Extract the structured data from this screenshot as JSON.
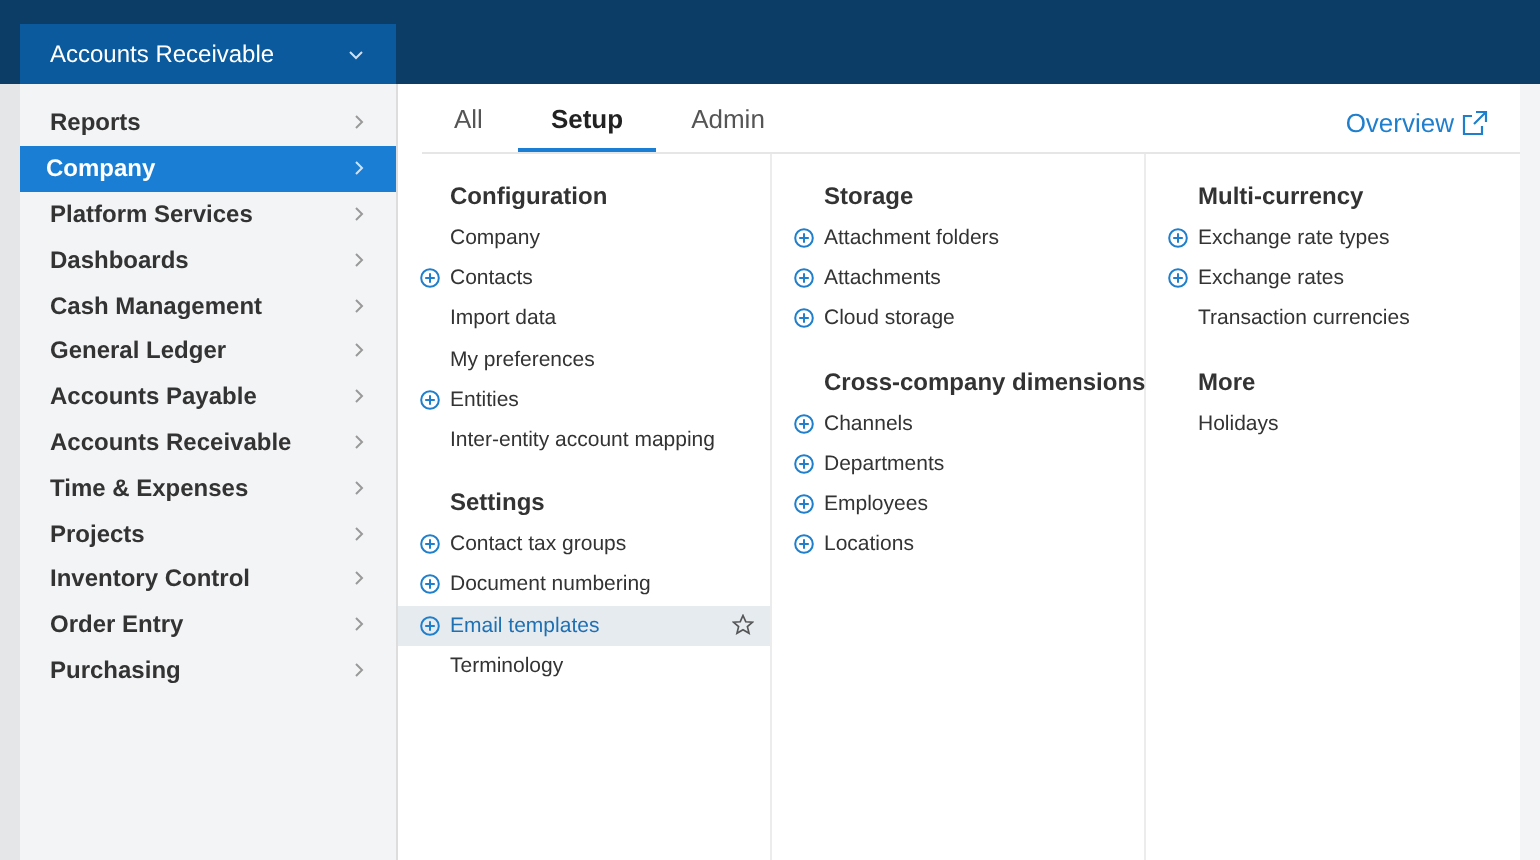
{
  "menu": {
    "title": "Accounts Receivable",
    "items": [
      {
        "label": "Reports",
        "selected": false
      },
      {
        "label": "Company",
        "selected": true
      },
      {
        "label": "Platform Services",
        "selected": false
      },
      {
        "label": "Dashboards",
        "selected": false
      },
      {
        "label": "Cash Management",
        "selected": false
      },
      {
        "label": "General Ledger",
        "selected": false
      },
      {
        "label": "Accounts Payable",
        "selected": false
      },
      {
        "label": "Accounts Receivable",
        "selected": false
      },
      {
        "label": "Time & Expenses",
        "selected": false
      },
      {
        "label": "Projects",
        "selected": false
      },
      {
        "label": "Inventory Control",
        "selected": false
      },
      {
        "label": "Order Entry",
        "selected": false
      },
      {
        "label": "Purchasing",
        "selected": false
      }
    ]
  },
  "tabs": [
    {
      "label": "All",
      "selected": false
    },
    {
      "label": "Setup",
      "selected": true
    },
    {
      "label": "Admin",
      "selected": false
    }
  ],
  "overview_link": "Overview",
  "columns": [
    [
      {
        "title": "Configuration",
        "items": [
          {
            "label": "Company",
            "addable": false,
            "selected": false
          },
          {
            "label": "Contacts",
            "addable": true,
            "selected": false
          },
          {
            "label": "Import data",
            "addable": false,
            "selected": false
          },
          {
            "label": "My preferences",
            "addable": false,
            "selected": false
          },
          {
            "label": "Entities",
            "addable": true,
            "selected": false
          },
          {
            "label": "Inter-entity account mapping",
            "addable": false,
            "selected": false
          }
        ]
      },
      {
        "title": "Settings",
        "items": [
          {
            "label": "Contact tax groups",
            "addable": true,
            "selected": false
          },
          {
            "label": "Document numbering",
            "addable": true,
            "selected": false
          },
          {
            "label": "Email templates",
            "addable": true,
            "selected": true
          },
          {
            "label": "Terminology",
            "addable": false,
            "selected": false
          }
        ]
      }
    ],
    [
      {
        "title": "Storage",
        "items": [
          {
            "label": "Attachment folders",
            "addable": true,
            "selected": false
          },
          {
            "label": "Attachments",
            "addable": true,
            "selected": false
          },
          {
            "label": "Cloud storage",
            "addable": true,
            "selected": false
          }
        ]
      },
      {
        "title": "Cross-company dimensions",
        "items": [
          {
            "label": "Channels",
            "addable": true,
            "selected": false
          },
          {
            "label": "Departments",
            "addable": true,
            "selected": false
          },
          {
            "label": "Employees",
            "addable": true,
            "selected": false
          },
          {
            "label": "Locations",
            "addable": true,
            "selected": false
          }
        ]
      }
    ],
    [
      {
        "title": "Multi-currency",
        "items": [
          {
            "label": "Exchange rate types",
            "addable": true,
            "selected": false
          },
          {
            "label": "Exchange rates",
            "addable": true,
            "selected": false
          },
          {
            "label": "Transaction currencies",
            "addable": false,
            "selected": false
          }
        ]
      },
      {
        "title": "More",
        "items": [
          {
            "label": "Holidays",
            "addable": false,
            "selected": false
          }
        ]
      }
    ]
  ]
}
